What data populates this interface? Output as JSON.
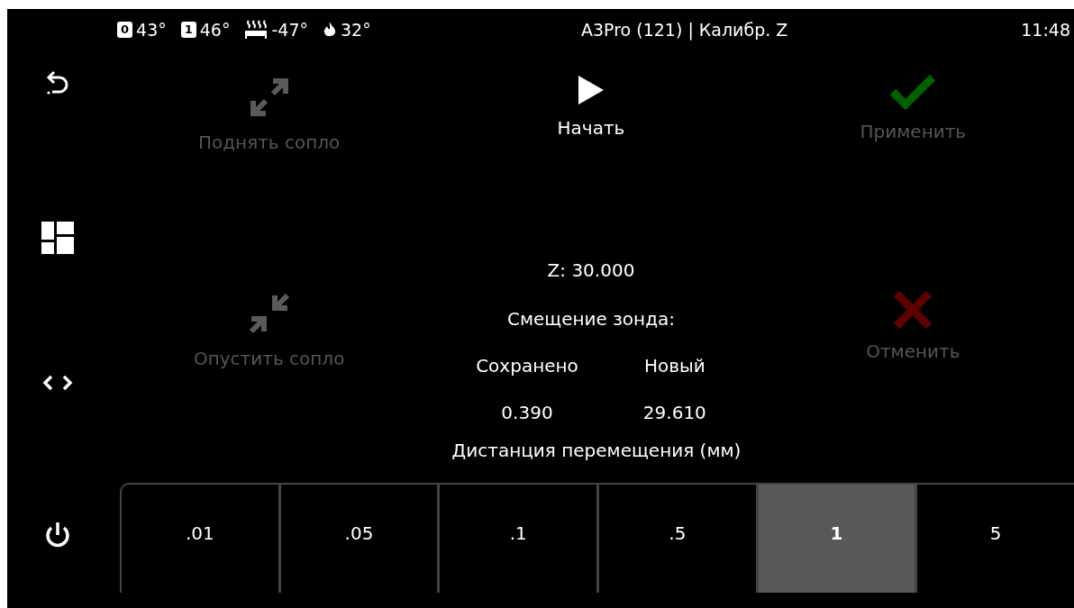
{
  "status_bar": {
    "sensors": [
      {
        "kind": "extruder",
        "badge": "0",
        "reading": "43°"
      },
      {
        "kind": "extruder",
        "badge": "1",
        "reading": "46°"
      },
      {
        "kind": "bed",
        "reading": "-47°"
      },
      {
        "kind": "flame",
        "reading": "32°"
      }
    ],
    "title": "A3Pro (121) | Калибр. Z",
    "time": "11:48"
  },
  "sidebar": {
    "items": [
      {
        "kind": "back"
      },
      {
        "kind": "grid"
      },
      {
        "kind": "code"
      },
      {
        "kind": "power"
      }
    ]
  },
  "actions": [
    {
      "kind": "raise",
      "label": "Поднять сопло",
      "disabled": true
    },
    {
      "kind": "start",
      "label": "Начать",
      "disabled": false
    },
    {
      "kind": "apply",
      "label": "Применить",
      "disabled": true
    },
    {
      "kind": "lower",
      "label": "Опустить сопло",
      "disabled": true
    },
    {
      "kind": "cancel",
      "label": "Отменить",
      "disabled": true
    }
  ],
  "z_position": "Z: 30.000",
  "probe_offset_title": "Смещение зонда:",
  "offsets": [
    {
      "heading": "Сохранено",
      "value": "0.390"
    },
    {
      "heading": "Новый",
      "value": "29.610"
    }
  ],
  "distance_title": "Дистанция перемещения (мм)",
  "distances": [
    {
      "label": ".01",
      "selected": false
    },
    {
      "label": ".05",
      "selected": false
    },
    {
      "label": ".1",
      "selected": false
    },
    {
      "label": ".5",
      "selected": false
    },
    {
      "label": "1",
      "selected": true
    },
    {
      "label": "5",
      "selected": false
    }
  ]
}
